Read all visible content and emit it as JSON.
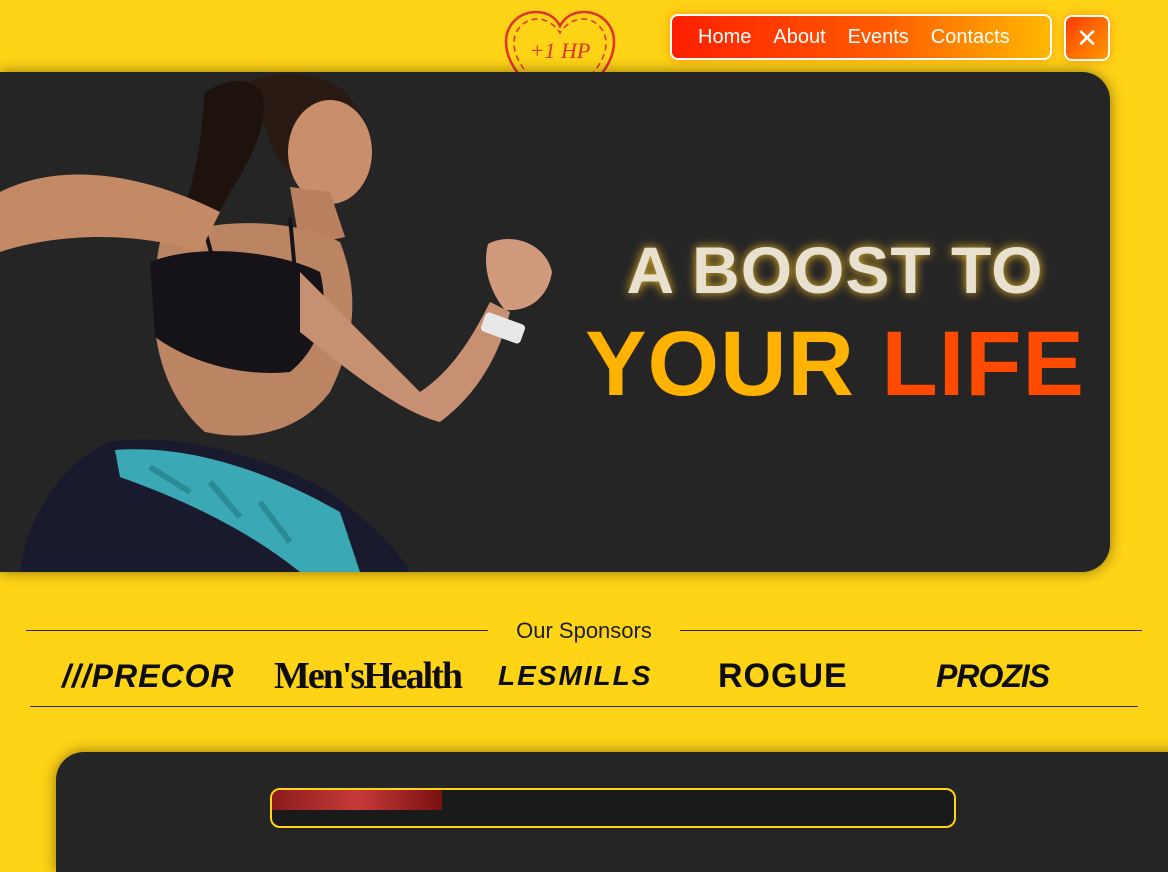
{
  "header": {
    "logo_text": "+1 HP",
    "nav": [
      {
        "label": "Home"
      },
      {
        "label": "About"
      },
      {
        "label": "Events"
      },
      {
        "label": "Contacts"
      }
    ],
    "close_icon": "close-icon",
    "nav_gradient": [
      "#FF1F00",
      "#FFB800"
    ]
  },
  "hero": {
    "line1": "A BOOST TO",
    "line2_word1": "YOUR",
    "line2_word2": "LIFE",
    "background": "#262526",
    "accent_yellow": "#FFB300",
    "accent_red": "#FF4A00"
  },
  "sponsors": {
    "title": "Our Sponsors",
    "items": [
      {
        "name": "///PRECOR"
      },
      {
        "name": "Men'sHealth"
      },
      {
        "name": "LESMILLS"
      },
      {
        "name": "ROGUE"
      },
      {
        "name": "PROZIS"
      }
    ]
  },
  "colors": {
    "page_background": "#FFD316",
    "text_dark": "#1E1E1E"
  }
}
